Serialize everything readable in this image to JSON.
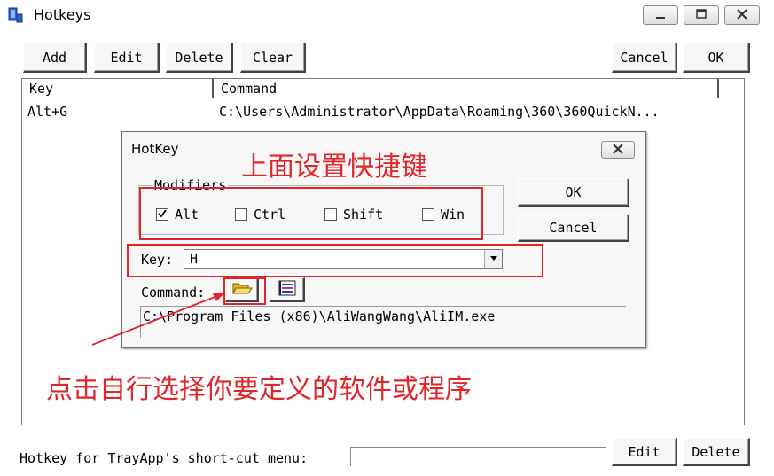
{
  "window": {
    "title": "Hotkeys"
  },
  "toolbar": {
    "add": "Add",
    "edit": "Edit",
    "delete": "Delete",
    "clear": "Clear",
    "cancel": "Cancel",
    "ok": "OK"
  },
  "list": {
    "columns": [
      "Key",
      "Command"
    ],
    "rows": [
      {
        "key": "Alt+G",
        "command": "C:\\Users\\Administrator\\AppData\\Roaming\\360\\360QuickN..."
      }
    ]
  },
  "dialog": {
    "title": "HotKey",
    "modifiers_label": "Modifiers",
    "modifiers": [
      {
        "label": "Alt",
        "checked": true
      },
      {
        "label": "Ctrl",
        "checked": false
      },
      {
        "label": "Shift",
        "checked": false
      },
      {
        "label": "Win",
        "checked": false
      }
    ],
    "ok": "OK",
    "cancel": "Cancel",
    "key_label": "Key:",
    "key_value": "H",
    "command_label": "Command:",
    "command_value": "C:\\Program Files (x86)\\AliWangWang\\AliIM.exe"
  },
  "annotations": {
    "top": "上面设置快捷键",
    "bottom": "点击自行选择你要定义的软件或程序"
  },
  "bottom": {
    "label": "Hotkey for TrayApp's short-cut menu:",
    "input_value": "",
    "edit": "Edit",
    "delete": "Delete"
  },
  "colors": {
    "annotation": "#e0262b",
    "folder_icon": "#f2d24a"
  },
  "icons": [
    "app-icon",
    "minimize-icon",
    "maximize-icon",
    "close-icon",
    "checkmark-icon",
    "dropdown-arrow-icon",
    "open-folder-icon",
    "list-menu-icon"
  ]
}
